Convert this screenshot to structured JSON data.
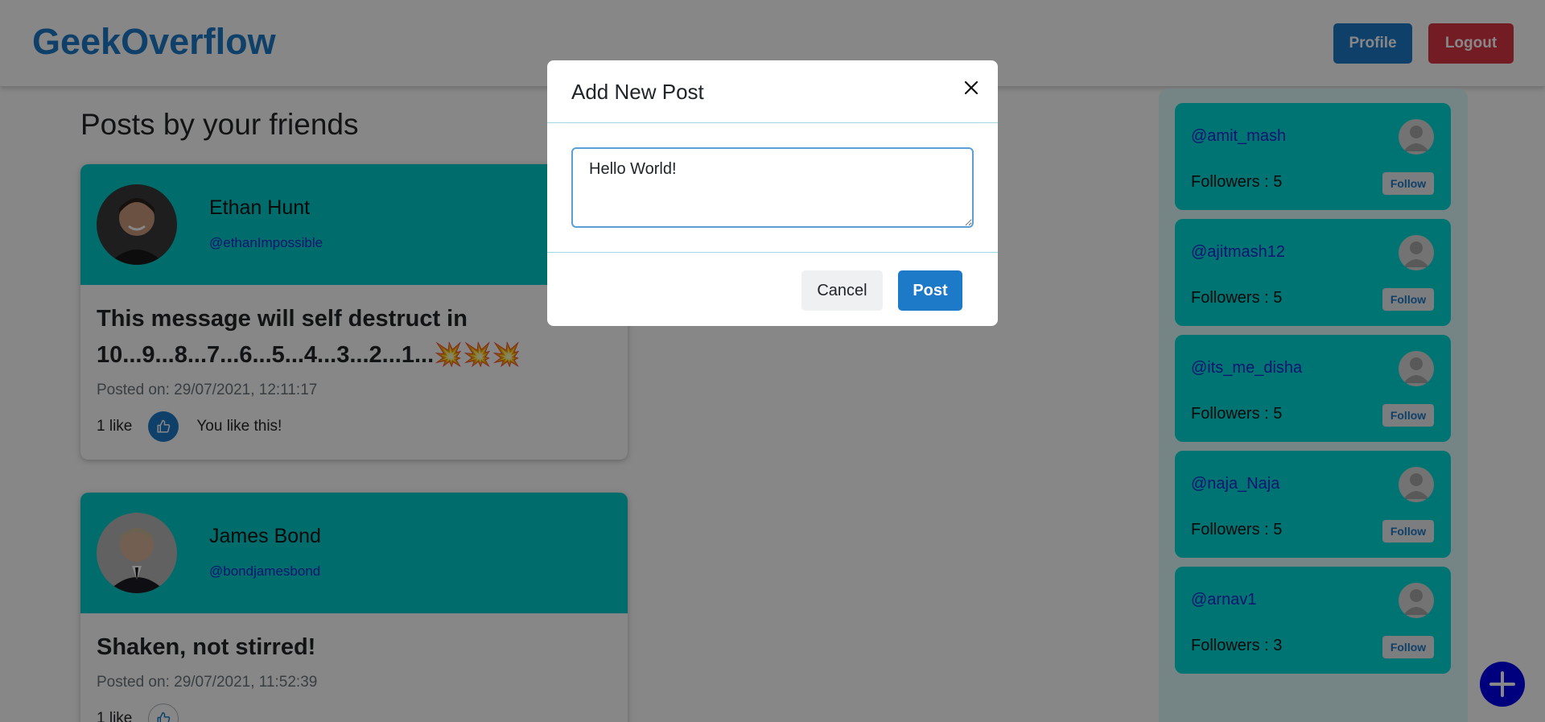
{
  "header": {
    "brand": "GeekOverflow",
    "profile_label": "Profile",
    "logout_label": "Logout"
  },
  "feed": {
    "title": "Posts by your friends",
    "posts": [
      {
        "name": "Ethan Hunt",
        "handle": "@ethanImpossible",
        "text": "This message will self destruct in 10...9...8...7...6...5...4...3...2...1...💥💥💥",
        "posted": "Posted on: 29/07/2021, 12:11:17",
        "likes": "1 like",
        "like_status": "You like this!"
      },
      {
        "name": "James Bond",
        "handle": "@bondjamesbond",
        "text": "Shaken, not stirred!",
        "posted": "Posted on: 29/07/2021, 11:52:39",
        "likes": "1 like",
        "like_status": ""
      }
    ]
  },
  "sidebar": {
    "users": [
      {
        "handle": "@amit_mash",
        "followers": "Followers : 5",
        "follow_label": "Follow"
      },
      {
        "handle": "@ajitmash12",
        "followers": "Followers : 5",
        "follow_label": "Follow"
      },
      {
        "handle": "@its_me_disha",
        "followers": "Followers : 5",
        "follow_label": "Follow"
      },
      {
        "handle": "@naja_Naja",
        "followers": "Followers : 5",
        "follow_label": "Follow"
      },
      {
        "handle": "@arnav1",
        "followers": "Followers : 3",
        "follow_label": "Follow"
      }
    ]
  },
  "modal": {
    "title": "Add New Post",
    "input_value": "Hello World!",
    "cancel_label": "Cancel",
    "post_label": "Post"
  },
  "icons": {
    "close": "close-icon",
    "like": "thumbs-up-icon",
    "add": "plus-icon",
    "avatar": "user-placeholder-icon"
  },
  "colors": {
    "brand": "#1d7ac8",
    "logout": "#dc3545",
    "card_teal": "#00cccc",
    "sidebar_card": "#00dada",
    "fab": "#0000ee"
  }
}
